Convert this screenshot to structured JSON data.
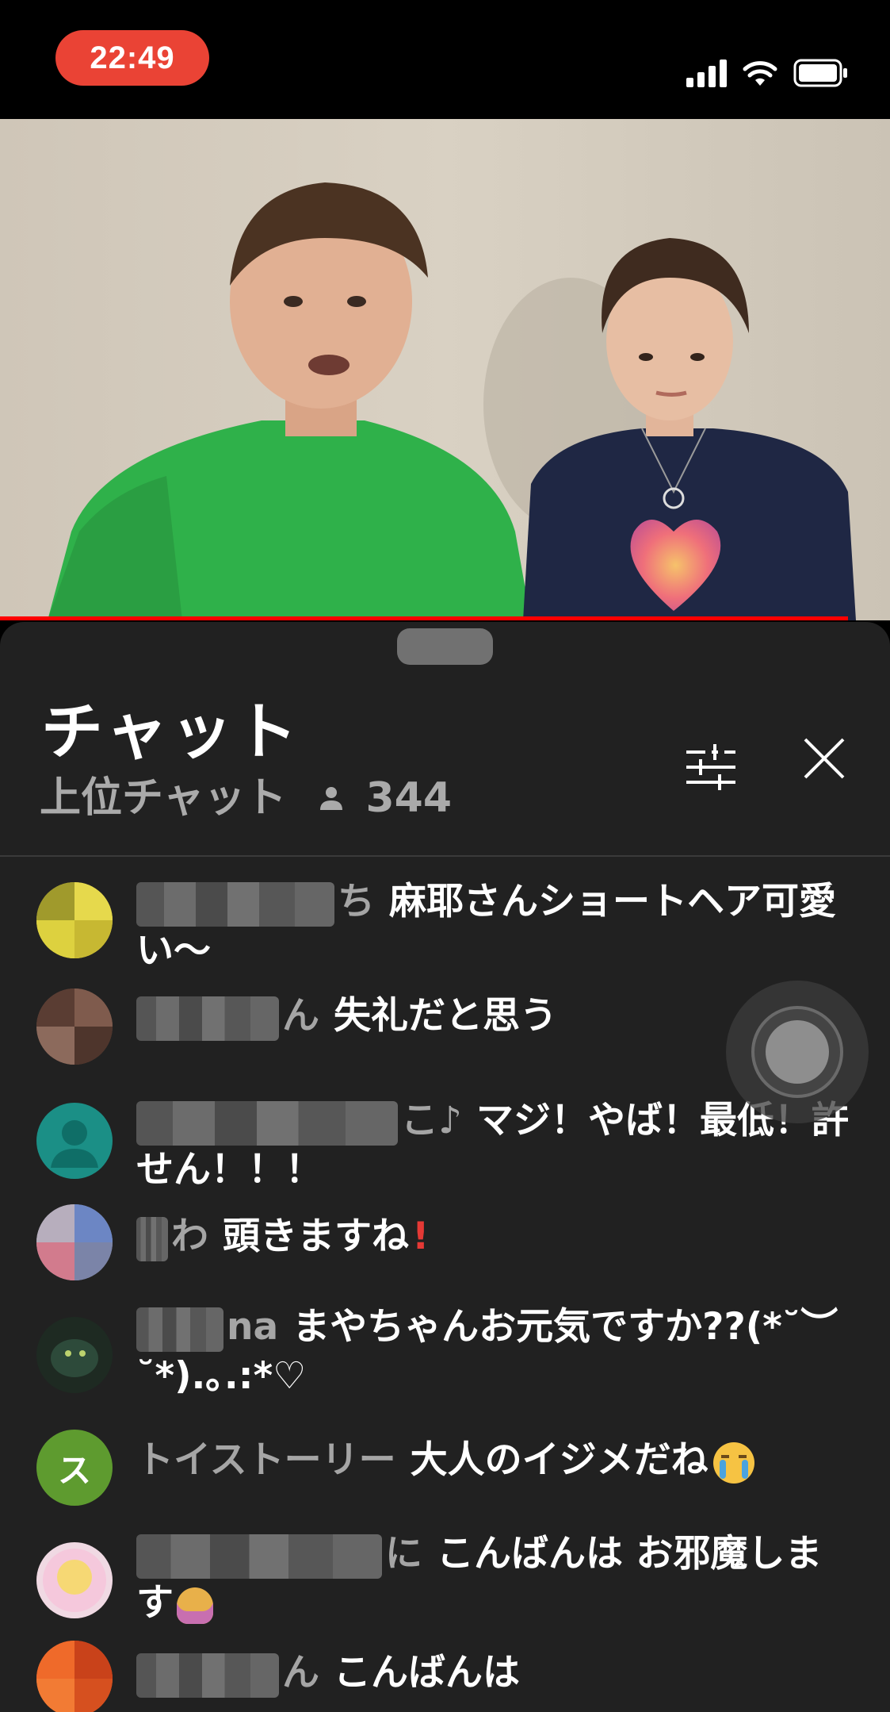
{
  "status_bar": {
    "time": "22:49"
  },
  "chat": {
    "title": "チャット",
    "mode_label": "上位チャット",
    "viewer_count": "344",
    "messages": [
      {
        "author_visible": "ち",
        "text": "麻耶さんショートヘア可愛い〜"
      },
      {
        "author_visible": "ん",
        "text": "失礼だと思う"
      },
      {
        "author_visible": "こ♪",
        "text": "マジ！やば！最低！許せん！！！"
      },
      {
        "author_visible": "わ",
        "text": "頭きますね"
      },
      {
        "author_visible": "na",
        "text": "まやちゃんお元気ですか??(*˘︶˘*).｡.:*♡"
      },
      {
        "author_visible": "トイストーリー",
        "avatar_letter": "ス",
        "text": "大人のイジメだね"
      },
      {
        "author_visible": "に",
        "text": "こんばんは お邪魔します"
      },
      {
        "author_visible": "ん",
        "text": "こんばんは"
      }
    ]
  },
  "colors": {
    "time_pill": "#ea4335",
    "panel_bg": "#212121",
    "author_gray": "#a5a5a5",
    "progress_red": "#ff0000"
  },
  "icons": {
    "filter": "sliders-icon",
    "close": "close-icon",
    "viewers": "person-icon"
  }
}
